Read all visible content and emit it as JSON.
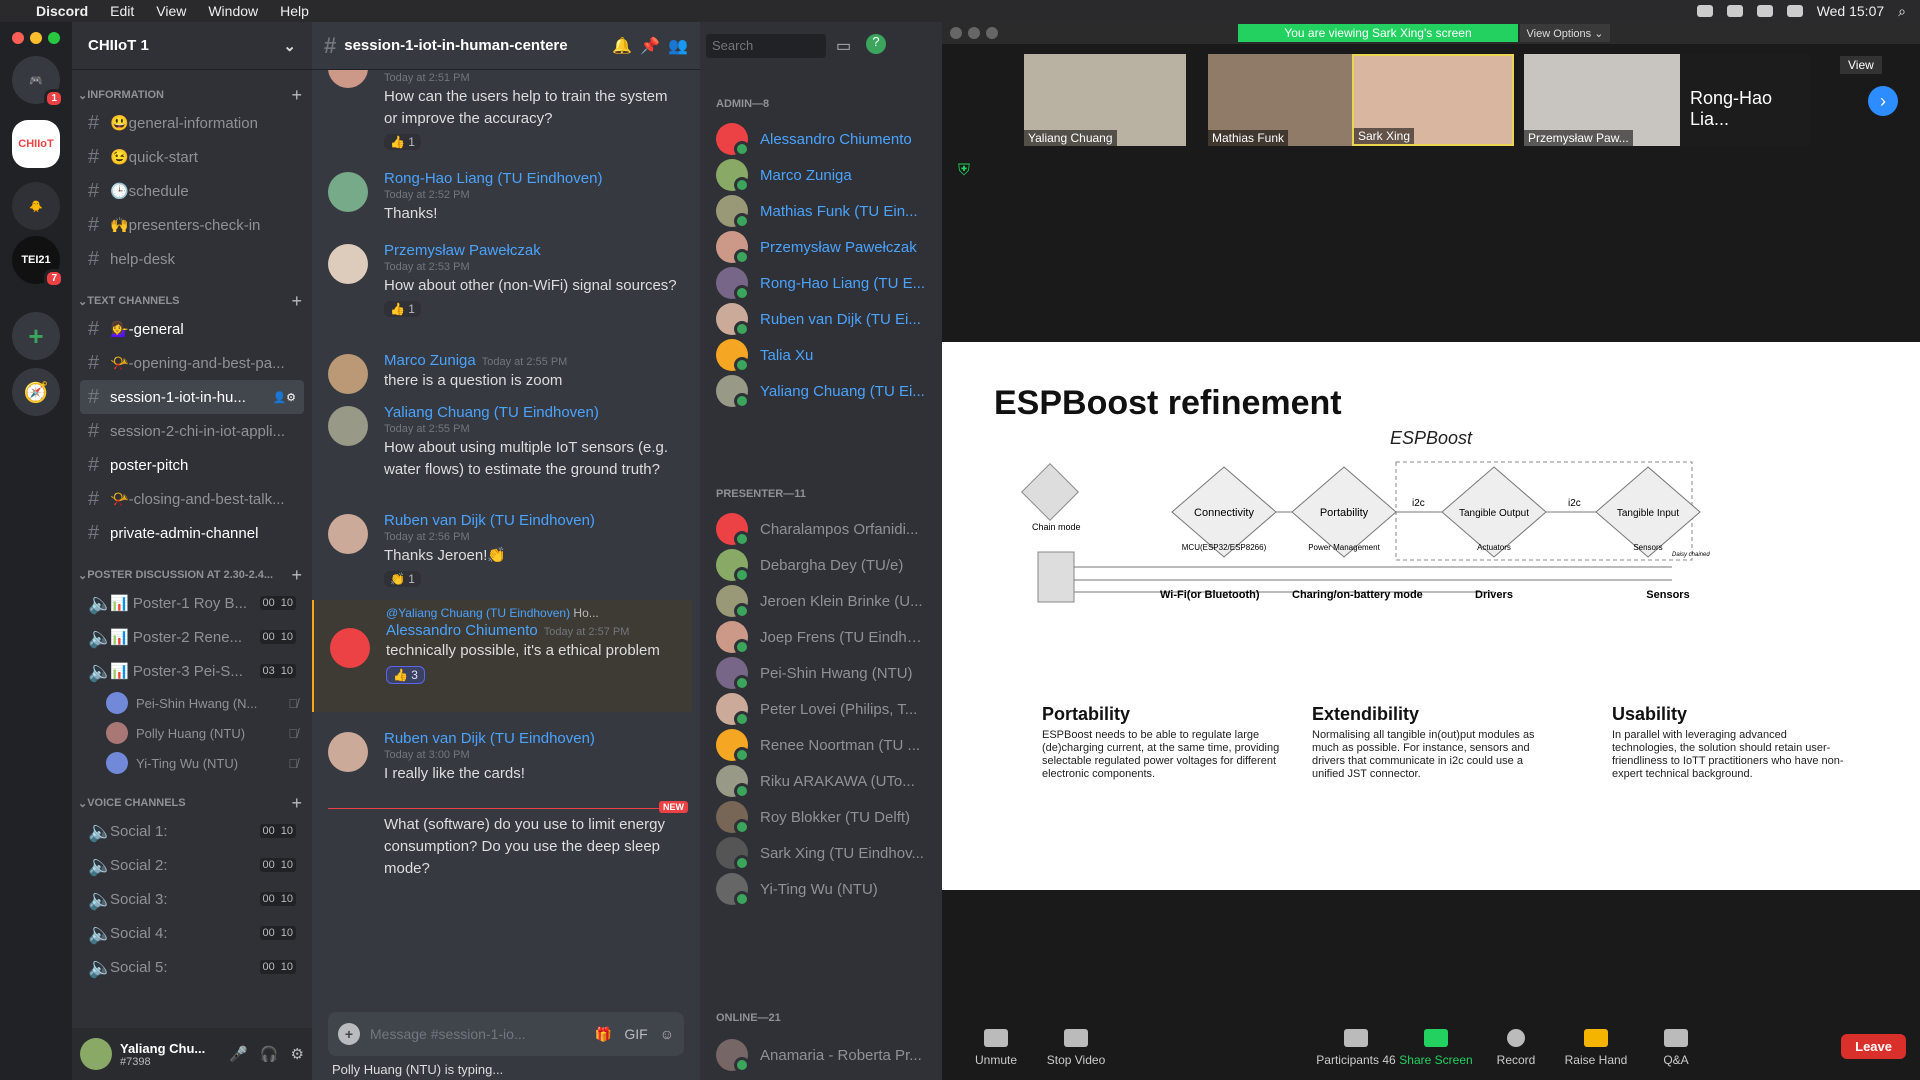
{
  "menubar": {
    "app": "Discord",
    "items": [
      "Edit",
      "View",
      "Window",
      "Help"
    ],
    "clock": "Wed 15:07"
  },
  "server": {
    "name": "CHIIoT 1"
  },
  "guild_badges": {
    "home": "1",
    "tei": "7"
  },
  "categories": {
    "information": "INFORMATION",
    "text": "TEXT CHANNELS",
    "poster": "POSTER DISCUSSION AT 2.30-2.4...",
    "voice": "VOICE CHANNELS"
  },
  "info_channels": [
    "😃general-information",
    "😉quick-start",
    "🕒schedule",
    "🙌presenters-check-in",
    "help-desk"
  ],
  "text_channels": [
    "💁‍♀️-general",
    "📯-opening-and-best-pa...",
    "session-1-iot-in-hu...",
    "session-2-chi-in-iot-appli...",
    "poster-pitch",
    "📯-closing-and-best-talk...",
    "private-admin-channel"
  ],
  "poster_channels": [
    {
      "name": "📊 Poster-1 Roy B...",
      "a": "00",
      "b": "10"
    },
    {
      "name": "📊 Poster-2 Rene...",
      "a": "00",
      "b": "10"
    },
    {
      "name": "📊 Poster-3 Pei-S...",
      "a": "03",
      "b": "10"
    }
  ],
  "poster_users": [
    "Pei-Shin Hwang (N...",
    "Polly Huang (NTU)",
    "Yi-Ting Wu (NTU)"
  ],
  "voice_channels": [
    {
      "name": "Social 1:",
      "a": "00",
      "b": "10"
    },
    {
      "name": "Social 2:",
      "a": "00",
      "b": "10"
    },
    {
      "name": "Social 3:",
      "a": "00",
      "b": "10"
    },
    {
      "name": "Social 4:",
      "a": "00",
      "b": "10"
    },
    {
      "name": "Social 5:",
      "a": "00",
      "b": "10"
    }
  ],
  "user": {
    "name": "Yaliang Chu...",
    "tag": "#7398"
  },
  "chat": {
    "channel": "session-1-iot-in-human-centere",
    "search_placeholder": "Search"
  },
  "messages": [
    {
      "author": "",
      "time": "Today at 2:51 PM",
      "text": "How can the users help to train the system or improve the accuracy?",
      "react": "👍 1"
    },
    {
      "author": "Rong-Hao Liang (TU Eindhoven)",
      "time": "Today at 2:52 PM",
      "text": "Thanks!",
      "react": ""
    },
    {
      "author": "Przemysław Pawełczak",
      "time": "Today at 2:53 PM",
      "text": "How about other (non-WiFi) signal sources?",
      "react": "👍 1"
    },
    {
      "author": "Marco Zuniga",
      "time": "Today at 2:55 PM",
      "text": "there is a question is zoom",
      "react": ""
    },
    {
      "author": "Yaliang Chuang (TU Eindhoven)",
      "time": "Today at 2:55 PM",
      "text": "How about using multiple IoT sensors (e.g. water flows) to estimate the ground truth?",
      "react": ""
    },
    {
      "author": "Ruben van Dijk (TU Eindhoven)",
      "time": "Today at 2:56 PM",
      "text": "Thanks Jeroen!👏",
      "react": "👏 1"
    },
    {
      "author": "Alessandro Chiumento",
      "time": "Today at 2:57 PM",
      "text": "technically possible, it's a ethical problem",
      "react": "👍 3",
      "reply": "@Yaliang Chuang (TU Eindhoven)",
      "reply_text": "Ho..."
    },
    {
      "author": "Ruben van Dijk (TU Eindhoven)",
      "time": "Today at 3:00 PM",
      "text": "I really like the cards!",
      "react": ""
    },
    {
      "author": "",
      "time": "",
      "text": "What (software) do you use to limit energy consumption? Do you use the deep sleep mode?",
      "react": ""
    }
  ],
  "new_label": "NEW",
  "composer_placeholder": "Message #session-1-io...",
  "typing": "Polly Huang (NTU) is typing...",
  "members": {
    "admin_header": "ADMIN—8",
    "admins": [
      "Alessandro Chiumento",
      "Marco Zuniga",
      "Mathias Funk (TU Ein...",
      "Przemysław Pawełczak",
      "Rong-Hao Liang (TU E...",
      "Ruben van Dijk (TU Ei...",
      "Talia Xu",
      "Yaliang Chuang (TU Ei..."
    ],
    "presenter_header": "PRESENTER—11",
    "presenters": [
      "Charalampos Orfanidi...",
      "Debargha Dey (TU/e)",
      "Jeroen Klein Brinke (U...",
      "Joep Frens (TU Eindho...",
      "Pei-Shin Hwang (NTU)",
      "Peter Lovei (Philips, T...",
      "Renee Noortman (TU ...",
      "Riku ARAKAWA (UTo...",
      "Roy Blokker (TU Delft)",
      "Sark Xing (TU Eindhov...",
      "Yi-Ting Wu (NTU)"
    ],
    "online_header": "ONLINE—21",
    "online": [
      "Anamaria - Roberta Pr..."
    ]
  },
  "zoom": {
    "banner": "You are viewing Sark Xing's screen",
    "view_options": "View Options ⌄",
    "view": "View",
    "tiles": [
      "Yaliang Chuang",
      "Mathias Funk",
      "Sark Xing",
      "Przemysław Paw...",
      "Rong-Hao Lia..."
    ],
    "participants_count": "46",
    "toolbar": [
      "Unmute",
      "Stop Video",
      "Participants",
      "Share Screen",
      "Record",
      "Raise Hand",
      "Q&A"
    ],
    "leave": "Leave"
  },
  "slide": {
    "title": "ESPBoost refinement",
    "diagram_title": "ESPBoost",
    "nodes": [
      "Connectivity",
      "Portability",
      "Tangible Output",
      "Tangible Input"
    ],
    "i2c": "i2c",
    "chain": "Chain mode",
    "labels": [
      "MCU(ESP32/ESP8266)",
      "Power Management",
      "Actuators",
      "Sensors",
      "Daisy chained"
    ],
    "bottom": [
      "Wi-Fi(or Bluetooth)",
      "Charing/on-battery mode",
      "Drivers",
      "Sensors"
    ],
    "sections": [
      {
        "h": "Portability",
        "p": "ESPBoost needs to be able to regulate large (de)charging current, at the same time, providing selectable regulated power voltages for different electronic components."
      },
      {
        "h": "Extendibility",
        "p": "Normalising all tangible in(out)put modules as much as possible. For instance, sensors and drivers that communicate in i2c could use a unified JST connector."
      },
      {
        "h": "Usability",
        "p": "In parallel with leveraging advanced technologies, the solution should retain user-friendliness to IoTT practitioners who have non-expert technical background."
      }
    ]
  }
}
